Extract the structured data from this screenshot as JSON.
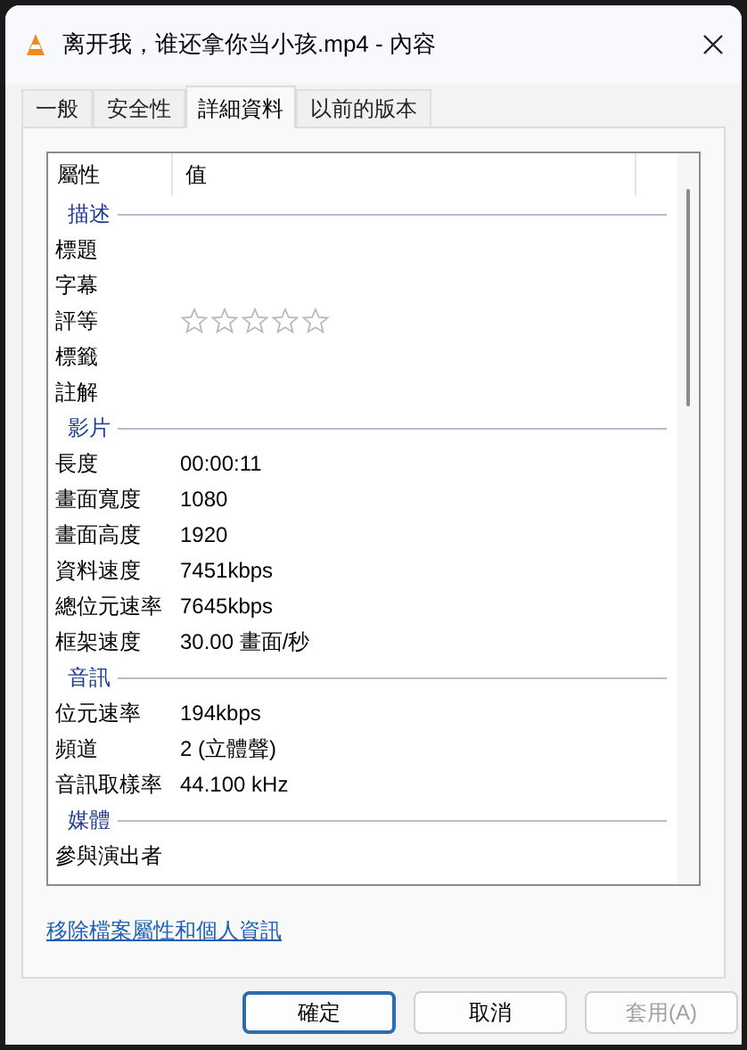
{
  "window": {
    "title": "离开我，谁还拿你当小孩.mp4 - 內容"
  },
  "tabs": [
    {
      "label": "一般",
      "selected": false
    },
    {
      "label": "安全性",
      "selected": false
    },
    {
      "label": "詳細資料",
      "selected": true
    },
    {
      "label": "以前的版本",
      "selected": false
    }
  ],
  "table": {
    "columns": [
      "屬性",
      "值"
    ],
    "groups": [
      {
        "name": "描述",
        "rows": [
          {
            "kind": "text",
            "property": "標題"
          },
          {
            "kind": "text",
            "property": "字幕"
          },
          {
            "kind": "rating",
            "property": "評等",
            "stars": 0
          },
          {
            "kind": "text",
            "property": "標籤"
          },
          {
            "kind": "text",
            "property": "註解"
          }
        ]
      },
      {
        "name": "影片",
        "rows": [
          {
            "kind": "text",
            "property": "長度",
            "value": "00:00:11"
          },
          {
            "kind": "text",
            "property": "畫面寬度",
            "value": "1080"
          },
          {
            "kind": "text",
            "property": "畫面高度",
            "value": "1920"
          },
          {
            "kind": "text",
            "property": "資料速度",
            "value": "7451kbps"
          },
          {
            "kind": "text",
            "property": "總位元速率",
            "value": "7645kbps"
          },
          {
            "kind": "text",
            "property": "框架速度",
            "value": "30.00 畫面/秒"
          }
        ]
      },
      {
        "name": "音訊",
        "rows": [
          {
            "kind": "text",
            "property": "位元速率",
            "value": "194kbps"
          },
          {
            "kind": "text",
            "property": "頻道",
            "value": "2 (立體聲)"
          },
          {
            "kind": "text",
            "property": "音訊取樣率",
            "value": "44.100 kHz"
          }
        ]
      },
      {
        "name": "媒體",
        "rows": [
          {
            "kind": "text",
            "property": "參與演出者"
          }
        ]
      }
    ]
  },
  "link": "移除檔案屬性和個人資訊",
  "buttons": [
    {
      "label": "確定",
      "default": true,
      "disabled": false
    },
    {
      "label": "取消",
      "default": false,
      "disabled": false
    },
    {
      "label": "套用(A)",
      "default": false,
      "disabled": true
    }
  ]
}
